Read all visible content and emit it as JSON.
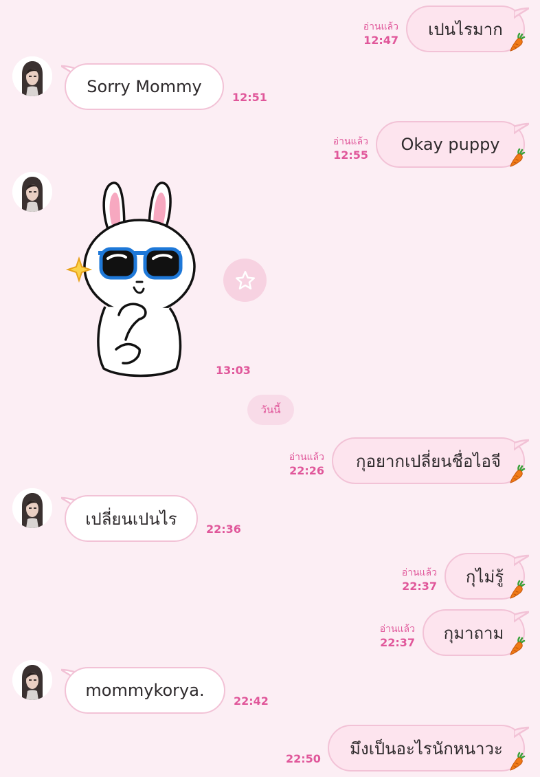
{
  "chat": {
    "read_label": "อ่านแล้ว",
    "date_separator": "วันนี้",
    "messages": [
      {
        "dir": "out",
        "text": "เปนไรมาก",
        "time": "12:47"
      },
      {
        "dir": "in",
        "text": "Sorry Mommy",
        "time": "12:51"
      },
      {
        "dir": "out",
        "text": "Okay puppy",
        "time": "12:55"
      },
      {
        "dir": "in",
        "type": "sticker",
        "sticker": "brown-cony-sunglasses-sticker",
        "time": "13:03"
      },
      {
        "dir": "out",
        "text": "กุอยากเปลี่ยนชื่อไอจี",
        "time": "22:26"
      },
      {
        "dir": "in",
        "text": "เปลี่ยนเปนไร",
        "time": "22:36"
      },
      {
        "dir": "out",
        "text": "กุไม่รู้",
        "time": "22:37"
      },
      {
        "dir": "out",
        "text": "กุมาถาม",
        "time": "22:37"
      },
      {
        "dir": "in",
        "text": "mommykorya.",
        "time": "22:42"
      },
      {
        "dir": "out",
        "text": "มึงเป็นอะไรนักหนาวะ",
        "time": "22:50"
      }
    ]
  },
  "icons": {
    "favorite": "star-icon",
    "bubble_decoration": "carrot-icon",
    "avatar": "contact-avatar"
  },
  "colors": {
    "background": "#fceef4",
    "incoming_bubble": "#ffffff",
    "outgoing_bubble": "#fde4ee",
    "bubble_border": "#f2c2d6",
    "accent_text": "#e0579a"
  }
}
